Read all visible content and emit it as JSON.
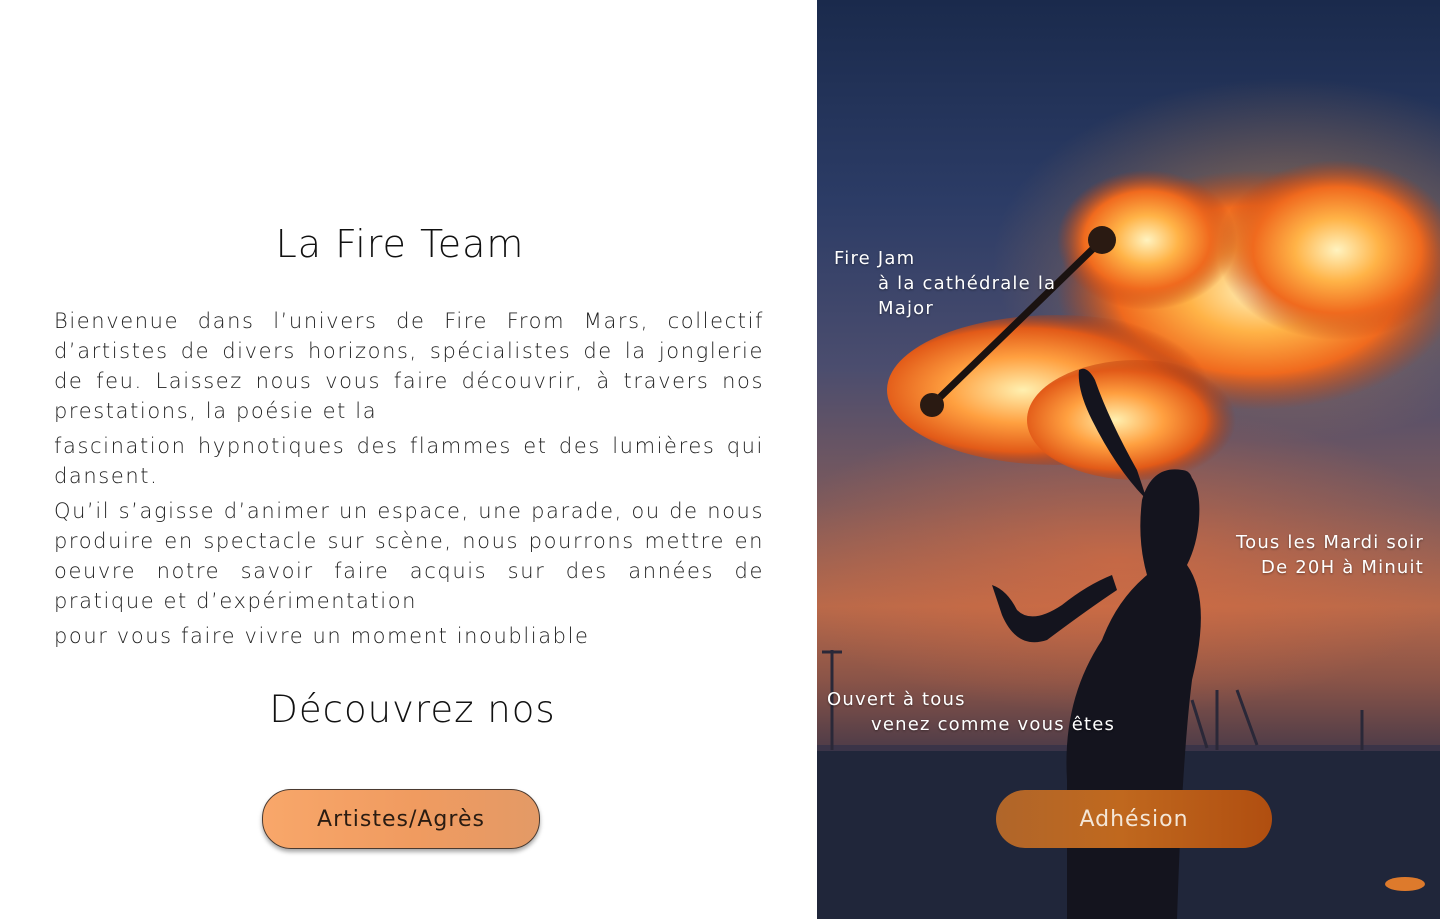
{
  "left": {
    "title": "La Fire Team",
    "paragraphs": [
      "Bienvenue dans l’univers de Fire From Mars, collectif d’artistes de divers horizons, spécialistes de la jonglerie de feu. Laissez nous vous faire découvrir, à travers nos prestations, la poésie et la",
      "fascination hypnotiques des flammes et des lumières qui dansent.",
      "Qu’il s’agisse d’animer un espace, une parade, ou de nous produire en spectacle sur scène, nous pourrons mettre en oeuvre notre savoir faire acquis sur des années de pratique et d’expérimentation",
      "pour vous faire vivre un moment inoubliable"
    ],
    "discover_heading": "Découvrez nos",
    "artists_button": "Artistes/Agrès"
  },
  "hero": {
    "image": "fire-juggler-photo",
    "fire_jam": {
      "line1": "Fire Jam",
      "line2": "à la cathédrale la Major"
    },
    "schedule": {
      "line1": "Tous  les  Mardi soir",
      "line2": "De 20H à Minuit"
    },
    "open": {
      "line1": "Ouvert à tous",
      "line2": "venez comme vous êtes"
    },
    "adhesion_button": "Adhésion"
  },
  "colors": {
    "artists_button": "#f4a06a",
    "adhesion_button": "#b8601e"
  }
}
